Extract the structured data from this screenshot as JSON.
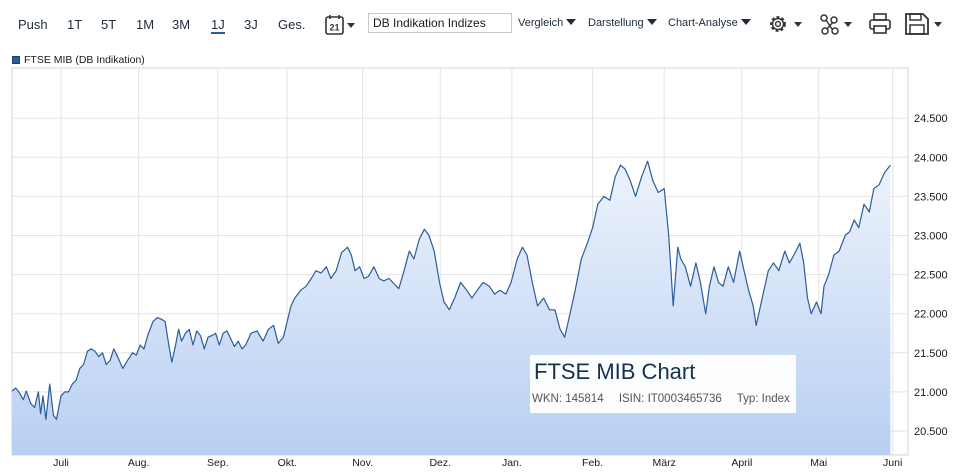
{
  "toolbar": {
    "timeframes": [
      "Push",
      "1T",
      "5T",
      "1M",
      "3M",
      "1J",
      "3J",
      "Ges."
    ],
    "active_timeframe": "1J",
    "calendar_day": "21",
    "index_select": "DB Indikation Indizes",
    "menus": [
      "Vergleich",
      "Darstellung",
      "Chart-Analyse"
    ],
    "icons": [
      "calendar-icon",
      "gear-icon",
      "share-icon",
      "print-icon",
      "save-icon"
    ]
  },
  "legend": {
    "label": "FTSE MIB (DB Indikation)",
    "color": "#2b5d9c"
  },
  "info": {
    "title": "FTSE MIB Chart",
    "wkn": "WKN: 145814",
    "isin": "ISIN: IT0003465736",
    "type": "Typ: Index"
  },
  "chart_data": {
    "type": "area",
    "title": "FTSE MIB Chart",
    "series": [
      {
        "name": "FTSE MIB (DB Indikation)",
        "color": "#2b5d9c"
      }
    ],
    "ylim": [
      20300,
      24800
    ],
    "yticks": [
      20500,
      21000,
      21500,
      22000,
      22500,
      23000,
      23500,
      24000,
      24500
    ],
    "ytick_labels": [
      "20.500",
      "21.000",
      "21.500",
      "22.000",
      "22.500",
      "23.000",
      "23.500",
      "24.000",
      "24.500"
    ],
    "x_labels": [
      "Juli",
      "Aug.",
      "Sep.",
      "Okt.",
      "Nov.",
      "Dez.",
      "Jan.",
      "Feb.",
      "März",
      "April",
      "Mai",
      "Juni"
    ],
    "x_label_pos": [
      0.0,
      1.03,
      2.08,
      3.0,
      4.0,
      5.03,
      5.98,
      7.05,
      8.0,
      9.03,
      10.05,
      11.03
    ],
    "x_max": 11.2,
    "grid": true,
    "points": [
      [
        -0.65,
        21010
      ],
      [
        -0.6,
        21050
      ],
      [
        -0.56,
        21000
      ],
      [
        -0.5,
        20900
      ],
      [
        -0.46,
        21010
      ],
      [
        -0.4,
        20850
      ],
      [
        -0.35,
        20800
      ],
      [
        -0.3,
        21000
      ],
      [
        -0.27,
        20720
      ],
      [
        -0.24,
        20950
      ],
      [
        -0.2,
        20650
      ],
      [
        -0.15,
        21100
      ],
      [
        -0.1,
        20700
      ],
      [
        -0.06,
        20650
      ],
      [
        0.0,
        20950
      ],
      [
        0.05,
        21000
      ],
      [
        0.1,
        21000
      ],
      [
        0.15,
        21100
      ],
      [
        0.2,
        21150
      ],
      [
        0.25,
        21300
      ],
      [
        0.3,
        21350
      ],
      [
        0.35,
        21520
      ],
      [
        0.4,
        21550
      ],
      [
        0.45,
        21520
      ],
      [
        0.5,
        21450
      ],
      [
        0.55,
        21500
      ],
      [
        0.6,
        21350
      ],
      [
        0.65,
        21400
      ],
      [
        0.7,
        21550
      ],
      [
        0.75,
        21450
      ],
      [
        0.82,
        21300
      ],
      [
        0.88,
        21400
      ],
      [
        0.95,
        21500
      ],
      [
        1.0,
        21470
      ],
      [
        1.05,
        21600
      ],
      [
        1.1,
        21550
      ],
      [
        1.15,
        21720
      ],
      [
        1.22,
        21900
      ],
      [
        1.28,
        21950
      ],
      [
        1.33,
        21930
      ],
      [
        1.38,
        21900
      ],
      [
        1.43,
        21600
      ],
      [
        1.47,
        21380
      ],
      [
        1.52,
        21600
      ],
      [
        1.56,
        21800
      ],
      [
        1.6,
        21650
      ],
      [
        1.65,
        21750
      ],
      [
        1.7,
        21800
      ],
      [
        1.75,
        21600
      ],
      [
        1.8,
        21780
      ],
      [
        1.85,
        21720
      ],
      [
        1.9,
        21550
      ],
      [
        1.95,
        21700
      ],
      [
        2.0,
        21720
      ],
      [
        2.05,
        21750
      ],
      [
        2.1,
        21600
      ],
      [
        2.15,
        21750
      ],
      [
        2.2,
        21780
      ],
      [
        2.25,
        21680
      ],
      [
        2.3,
        21580
      ],
      [
        2.35,
        21650
      ],
      [
        2.4,
        21550
      ],
      [
        2.45,
        21600
      ],
      [
        2.52,
        21750
      ],
      [
        2.6,
        21780
      ],
      [
        2.68,
        21650
      ],
      [
        2.75,
        21800
      ],
      [
        2.82,
        21850
      ],
      [
        2.88,
        21620
      ],
      [
        2.95,
        21700
      ],
      [
        3.0,
        21900
      ],
      [
        3.05,
        22100
      ],
      [
        3.1,
        22200
      ],
      [
        3.18,
        22300
      ],
      [
        3.25,
        22350
      ],
      [
        3.32,
        22450
      ],
      [
        3.38,
        22550
      ],
      [
        3.45,
        22520
      ],
      [
        3.52,
        22600
      ],
      [
        3.58,
        22450
      ],
      [
        3.65,
        22550
      ],
      [
        3.72,
        22780
      ],
      [
        3.8,
        22850
      ],
      [
        3.85,
        22750
      ],
      [
        3.9,
        22550
      ],
      [
        3.96,
        22600
      ],
      [
        4.02,
        22450
      ],
      [
        4.08,
        22480
      ],
      [
        4.15,
        22600
      ],
      [
        4.22,
        22450
      ],
      [
        4.28,
        22420
      ],
      [
        4.35,
        22450
      ],
      [
        4.42,
        22380
      ],
      [
        4.48,
        22320
      ],
      [
        4.55,
        22550
      ],
      [
        4.62,
        22800
      ],
      [
        4.68,
        22700
      ],
      [
        4.75,
        22950
      ],
      [
        4.82,
        23080
      ],
      [
        4.88,
        23000
      ],
      [
        4.95,
        22800
      ],
      [
        5.02,
        22400
      ],
      [
        5.08,
        22150
      ],
      [
        5.15,
        22050
      ],
      [
        5.22,
        22200
      ],
      [
        5.3,
        22400
      ],
      [
        5.38,
        22300
      ],
      [
        5.45,
        22200
      ],
      [
        5.52,
        22300
      ],
      [
        5.6,
        22400
      ],
      [
        5.68,
        22350
      ],
      [
        5.75,
        22250
      ],
      [
        5.82,
        22300
      ],
      [
        5.9,
        22250
      ],
      [
        5.97,
        22400
      ],
      [
        6.05,
        22700
      ],
      [
        6.12,
        22850
      ],
      [
        6.18,
        22750
      ],
      [
        6.25,
        22400
      ],
      [
        6.32,
        22100
      ],
      [
        6.4,
        22200
      ],
      [
        6.48,
        22050
      ],
      [
        6.55,
        22050
      ],
      [
        6.62,
        21800
      ],
      [
        6.68,
        21700
      ],
      [
        6.75,
        22000
      ],
      [
        6.82,
        22300
      ],
      [
        6.9,
        22700
      ],
      [
        6.98,
        22900
      ],
      [
        7.05,
        23100
      ],
      [
        7.12,
        23400
      ],
      [
        7.2,
        23500
      ],
      [
        7.28,
        23450
      ],
      [
        7.35,
        23750
      ],
      [
        7.42,
        23900
      ],
      [
        7.48,
        23850
      ],
      [
        7.55,
        23700
      ],
      [
        7.62,
        23500
      ],
      [
        7.7,
        23750
      ],
      [
        7.78,
        23950
      ],
      [
        7.85,
        23700
      ],
      [
        7.92,
        23550
      ],
      [
        8.0,
        23600
      ],
      [
        8.06,
        23000
      ],
      [
        8.12,
        22100
      ],
      [
        8.18,
        22850
      ],
      [
        8.22,
        22700
      ],
      [
        8.28,
        22600
      ],
      [
        8.35,
        22350
      ],
      [
        8.42,
        22650
      ],
      [
        8.48,
        22400
      ],
      [
        8.55,
        22000
      ],
      [
        8.6,
        22350
      ],
      [
        8.66,
        22600
      ],
      [
        8.72,
        22400
      ],
      [
        8.78,
        22350
      ],
      [
        8.85,
        22600
      ],
      [
        8.92,
        22400
      ],
      [
        9.0,
        22800
      ],
      [
        9.06,
        22550
      ],
      [
        9.12,
        22300
      ],
      [
        9.18,
        22100
      ],
      [
        9.22,
        21850
      ],
      [
        9.3,
        22200
      ],
      [
        9.38,
        22550
      ],
      [
        9.45,
        22650
      ],
      [
        9.52,
        22550
      ],
      [
        9.6,
        22800
      ],
      [
        9.66,
        22650
      ],
      [
        9.72,
        22750
      ],
      [
        9.8,
        22900
      ],
      [
        9.85,
        22650
      ],
      [
        9.9,
        22200
      ],
      [
        9.95,
        22000
      ],
      [
        10.02,
        22150
      ],
      [
        10.08,
        22000
      ],
      [
        10.12,
        22350
      ],
      [
        10.18,
        22500
      ],
      [
        10.25,
        22750
      ],
      [
        10.32,
        22800
      ],
      [
        10.4,
        23000
      ],
      [
        10.46,
        23050
      ],
      [
        10.52,
        23200
      ],
      [
        10.58,
        23100
      ],
      [
        10.65,
        23400
      ],
      [
        10.72,
        23300
      ],
      [
        10.78,
        23600
      ],
      [
        10.85,
        23650
      ],
      [
        10.92,
        23800
      ],
      [
        11.0,
        23900
      ]
    ]
  }
}
